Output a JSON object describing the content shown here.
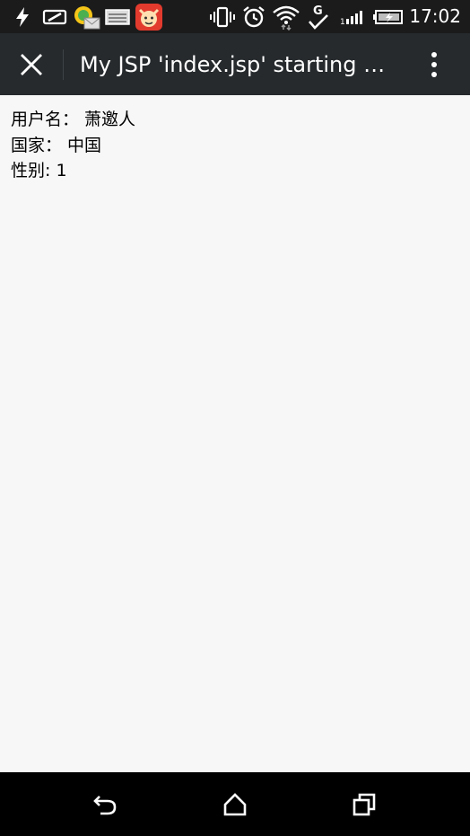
{
  "status_bar": {
    "time": "17:02",
    "icons": [
      "flash-icon",
      "battery-saver-icon",
      "chat-mail-icon",
      "keyboard-icon",
      "app-icon",
      "vibrate-icon",
      "alarm-icon",
      "wifi-icon",
      "g-network-icon",
      "signal-icon",
      "battery-charging-icon"
    ]
  },
  "toolbar": {
    "title": "My JSP 'index.jsp' starting p..."
  },
  "content": {
    "lines": [
      "用户名： 萧邀人",
      "国家： 中国",
      "性别: 1"
    ]
  },
  "nav_bar": {
    "buttons": [
      "back-icon",
      "home-icon",
      "recents-icon"
    ]
  }
}
